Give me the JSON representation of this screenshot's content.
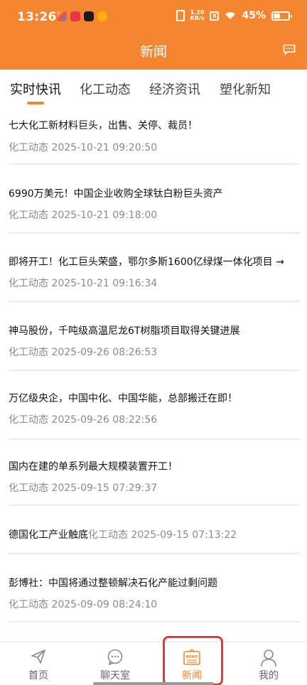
{
  "status_bar": {
    "time": "13:26",
    "net_speed_top": "1.20",
    "net_speed_bottom": "KB/s",
    "sim_badge": "X",
    "battery_percent": "45%"
  },
  "header": {
    "title": "新闻"
  },
  "tabs": [
    {
      "label": "实时快讯",
      "active": true
    },
    {
      "label": "化工动态",
      "active": false
    },
    {
      "label": "经济资讯",
      "active": false
    },
    {
      "label": "塑化新知",
      "active": false
    }
  ],
  "news": [
    {
      "title": "七大化工新材料巨头，出售、关停、裁员！",
      "meta": "化工动态 2025-10-21 09:20:50"
    },
    {
      "title": "6990万美元！中国企业收购全球钛白粉巨头资产",
      "meta": "化工动态 2025-10-21 09:18:00"
    },
    {
      "title": "即将开工！化工巨头荣盛，鄂尔多斯1600亿绿煤一体化项目 →",
      "meta": "化工动态 2025-10-21 09:16:34"
    },
    {
      "title": "神马股份，千吨级高温尼龙6T树脂项目取得关键进展",
      "meta": "化工动态 2025-09-26 08:26:53"
    },
    {
      "title": "万亿级央企，中国中化、中国华能，总部搬迁在即！",
      "meta": "化工动态 2025-09-26 08:22:56"
    },
    {
      "title": "国内在建的单系列最大规模装置开工！",
      "meta": "化工动态 2025-09-15 07:29:37"
    },
    {
      "title": "德国化工产业触底",
      "meta": "化工动态 2025-09-15 07:13:22"
    },
    {
      "title": "彭博社：中国将通过整顿解决石化产能过剩问题",
      "meta": "化工动态 2025-09-09 08:24:10"
    }
  ],
  "bottom_nav": [
    {
      "label": "首页",
      "icon": "paper-plane-icon",
      "active": false
    },
    {
      "label": "聊天室",
      "icon": "chat-bubble-icon",
      "active": false
    },
    {
      "label": "新闻",
      "icon": "news-icon",
      "active": true
    },
    {
      "label": "我的",
      "icon": "person-icon",
      "active": false
    }
  ],
  "colors": {
    "accent": "#f5862f",
    "highlight": "#e23a3a"
  }
}
